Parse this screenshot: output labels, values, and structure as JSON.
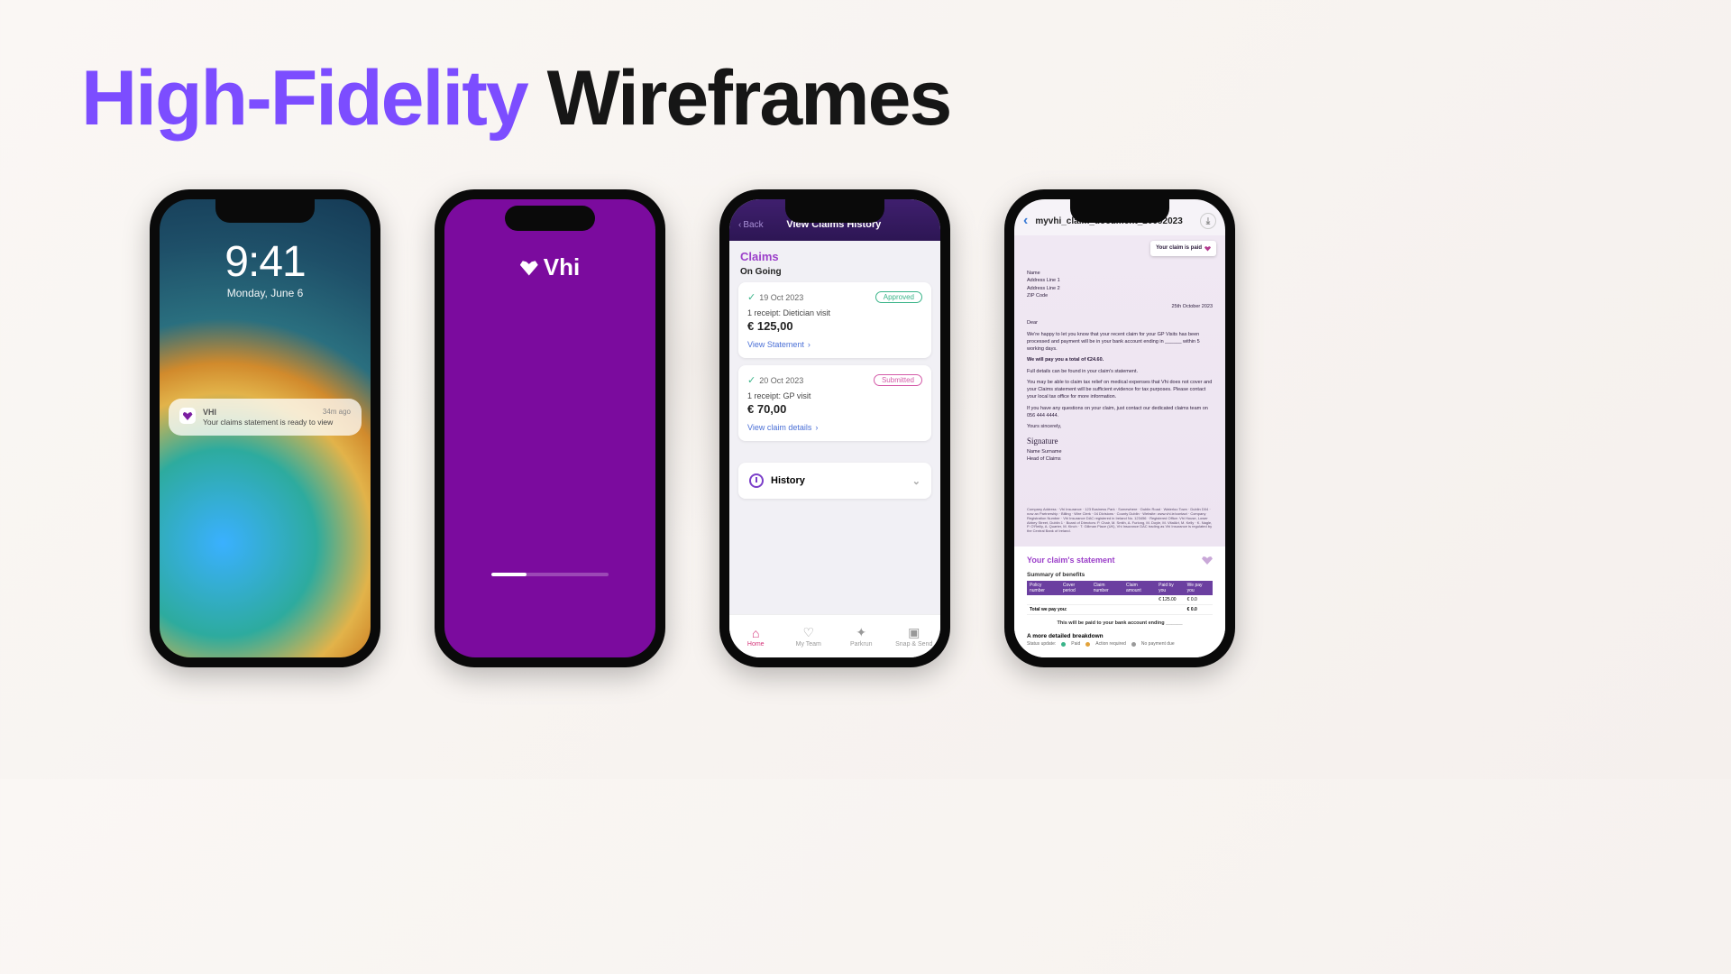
{
  "title": {
    "part1": "High-Fidelity",
    "part2": " Wireframes"
  },
  "phone1": {
    "time": "9:41",
    "date": "Monday, June 6",
    "notif": {
      "app": "VHI",
      "ago": "34m ago",
      "msg": "Your claims statement is ready to view"
    }
  },
  "phone2": {
    "logo_text": "Vhi"
  },
  "phone3": {
    "back": "Back",
    "header": "View Claims History",
    "section": "Claims",
    "subhead": "On Going",
    "claims": [
      {
        "date": "19 Oct 2023",
        "status": "Approved",
        "status_kind": "approved",
        "receipt": "1 receipt: Dietician visit",
        "amount": "€ 125,00",
        "link": "View Statement"
      },
      {
        "date": "20 Oct 2023",
        "status": "Submitted",
        "status_kind": "submitted",
        "receipt": "1 receipt: GP visit",
        "amount": "€ 70,00",
        "link": "View claim details"
      }
    ],
    "history": "History",
    "tabs": [
      {
        "label": "Home",
        "active": true
      },
      {
        "label": "My Team",
        "active": false
      },
      {
        "label": "Parkrun",
        "active": false
      },
      {
        "label": "Snap & Send",
        "active": false
      }
    ]
  },
  "phone4": {
    "docname": "myvhi_claim_document_20092023",
    "tag": "Your claim is paid",
    "addr": [
      "Name",
      "Address Line 1",
      "Address Line 2",
      "ZIP Code"
    ],
    "letter_date": "25th October 2023",
    "para1": "Dear",
    "para2": "We're happy to let you know that your recent claim for your GP Visits has been processed and payment will be in your bank account ending in ______ within 5 working days.",
    "para3": "We will pay you a total of €24.60.",
    "para4": "Full details can be found in your claim's statement.",
    "para5": "You may be able to claim tax relief on medical expenses that Vhi does not cover and your Claims statement will be sufficient evidence for tax purposes. Please contact your local tax office for more information.",
    "para6": "If you have any questions on your claim, just contact our dedicated claims team on 056 444 4444.",
    "para7": "Yours sincerely,",
    "signature": "Signature",
    "signer": [
      "Name Surname",
      "Head of Claims"
    ],
    "stmt_title": "Your claim's statement",
    "stmt_sub": "Summary of benefits",
    "table": {
      "headers": [
        "Policy number",
        "Cover period",
        "Claim number",
        "Claim amount",
        "Paid by you",
        "We pay you"
      ],
      "row": [
        "",
        "",
        "",
        "",
        "€ 125.00",
        "€ 0.0"
      ],
      "total_label": "Total we pay you:",
      "total_value": "€ 0.0"
    },
    "note": "This will be paid to your bank account ending ______",
    "breakdown_h": "A more detailed breakdown",
    "legend": {
      "label": "Status update:",
      "paid": "Paid",
      "action": "Action required",
      "none": "No payment due"
    }
  }
}
